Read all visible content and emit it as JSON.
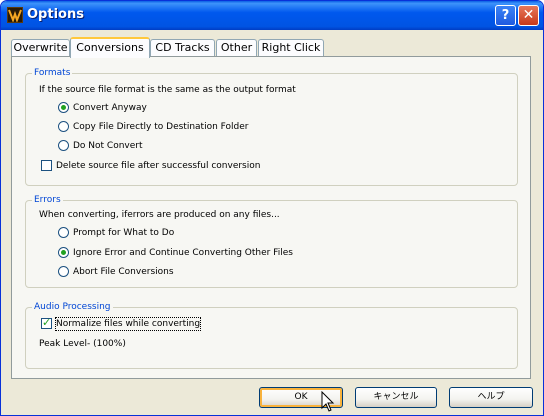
{
  "window": {
    "title": "Options",
    "help_button": "?",
    "close_button": "✕"
  },
  "tabs": [
    {
      "label": "Overwrite",
      "active": false
    },
    {
      "label": "Conversions",
      "active": true
    },
    {
      "label": "CD Tracks",
      "active": false
    },
    {
      "label": "Other",
      "active": false
    },
    {
      "label": "Right Click",
      "active": false
    }
  ],
  "formats": {
    "title": "Formats",
    "description": "If the source file format is the same as the output format",
    "options": [
      {
        "label": "Convert Anyway",
        "selected": true
      },
      {
        "label": "Copy File Directly to Destination Folder",
        "selected": false
      },
      {
        "label": "Do Not Convert",
        "selected": false
      }
    ],
    "delete_source": {
      "label": "Delete source file after successful conversion",
      "checked": false
    }
  },
  "errors": {
    "title": "Errors",
    "description": "When converting, iferrors are produced on any files...",
    "options": [
      {
        "label": "Prompt for What to Do",
        "selected": false
      },
      {
        "label": "Ignore Error and Continue Converting Other Files",
        "selected": true
      },
      {
        "label": "Abort File Conversions",
        "selected": false
      }
    ]
  },
  "audio": {
    "title": "Audio Processing",
    "normalize": {
      "label": "Normalize files while converting",
      "checked": true
    },
    "peak_label": "Peak Level- (100%)",
    "peak_value_percent": 100
  },
  "buttons": {
    "ok": "OK",
    "cancel": "キャンセル",
    "help": "ヘルプ"
  },
  "colors": {
    "titlebar": "#0054e3",
    "group_title": "#0046d5",
    "default_button_highlight": "#f8b23c",
    "radio_dot": "#21a121"
  }
}
